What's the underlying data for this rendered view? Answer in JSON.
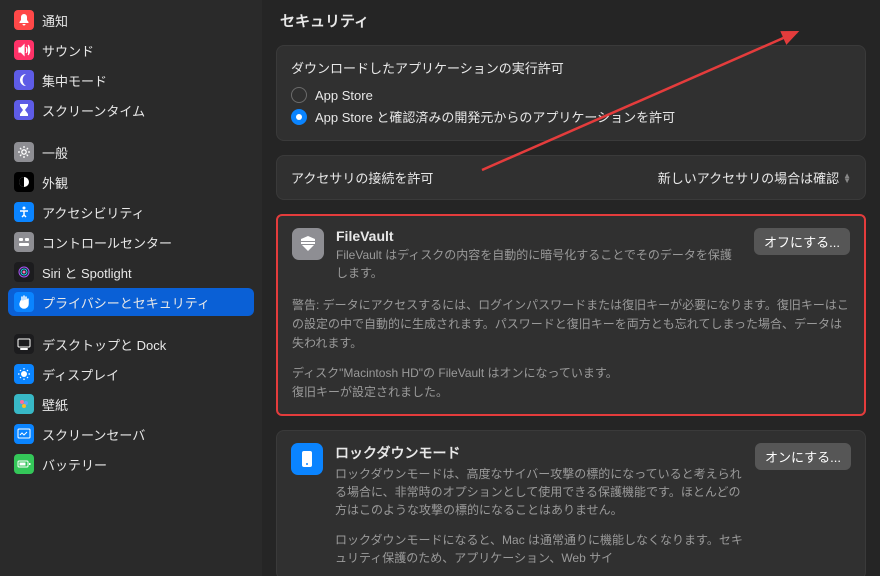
{
  "sidebar": [
    {
      "icon": "bell",
      "bg": "#ff4848",
      "label": "通知"
    },
    {
      "icon": "sound",
      "bg": "#ff3268",
      "label": "サウンド"
    },
    {
      "icon": "moon",
      "bg": "#5e5ce6",
      "label": "集中モード"
    },
    {
      "icon": "hourglass",
      "bg": "#5e5ce6",
      "label": "スクリーンタイム"
    },
    {
      "sep": true
    },
    {
      "icon": "gear",
      "bg": "#8e8e93",
      "label": "一般"
    },
    {
      "icon": "appear",
      "bg": "#000",
      "label": "外観"
    },
    {
      "icon": "access",
      "bg": "#0a84ff",
      "label": "アクセシビリティ"
    },
    {
      "icon": "cc",
      "bg": "#8e8e93",
      "label": "コントロールセンター"
    },
    {
      "icon": "siri",
      "bg": "#1c1c1e",
      "label": "Siri と Spotlight"
    },
    {
      "icon": "hand",
      "bg": "#0a84ff",
      "label": "プライバシーとセキュリティ",
      "sel": true
    },
    {
      "sep": true
    },
    {
      "icon": "dock",
      "bg": "#1c1c1e",
      "label": "デスクトップと Dock"
    },
    {
      "icon": "display",
      "bg": "#0a84ff",
      "label": "ディスプレイ"
    },
    {
      "icon": "wall",
      "bg": "#38b8c6",
      "label": "壁紙"
    },
    {
      "icon": "saver",
      "bg": "#0a84ff",
      "label": "スクリーンセーバ"
    },
    {
      "icon": "battery",
      "bg": "#34c759",
      "label": "バッテリー"
    }
  ],
  "page_title": "セキュリティ",
  "download": {
    "heading": "ダウンロードしたアプリケーションの実行許可",
    "opt1": "App Store",
    "opt2": "App Store と確認済みの開発元からのアプリケーションを許可"
  },
  "accessory": {
    "label": "アクセサリの接続を許可",
    "value": "新しいアクセサリの場合は確認"
  },
  "filevault": {
    "title": "FileVault",
    "desc": "FileVault はディスクの内容を自動的に暗号化することでそのデータを保護します。",
    "button": "オフにする...",
    "warning": "警告: データにアクセスするには、ログインパスワードまたは復旧キーが必要になります。復旧キーはこの設定の中で自動的に生成されます。パスワードと復旧キーを両方とも忘れてしまった場合、データは失われます。",
    "status1": "ディスク\"Macintosh HD\"の FileVault はオンになっています。",
    "status2": "復旧キーが設定されました。"
  },
  "lockdown": {
    "title": "ロックダウンモード",
    "desc": "ロックダウンモードは、高度なサイバー攻撃の標的になっていると考えられる場合に、非常時のオプションとして使用できる保護機能です。ほとんどの方はこのような攻撃の標的になることはありません。",
    "button": "オンにする...",
    "note": "ロックダウンモードになると、Mac は通常通りに機能しなくなります。セキュリティ保護のため、アプリケーション、Web サイ"
  }
}
